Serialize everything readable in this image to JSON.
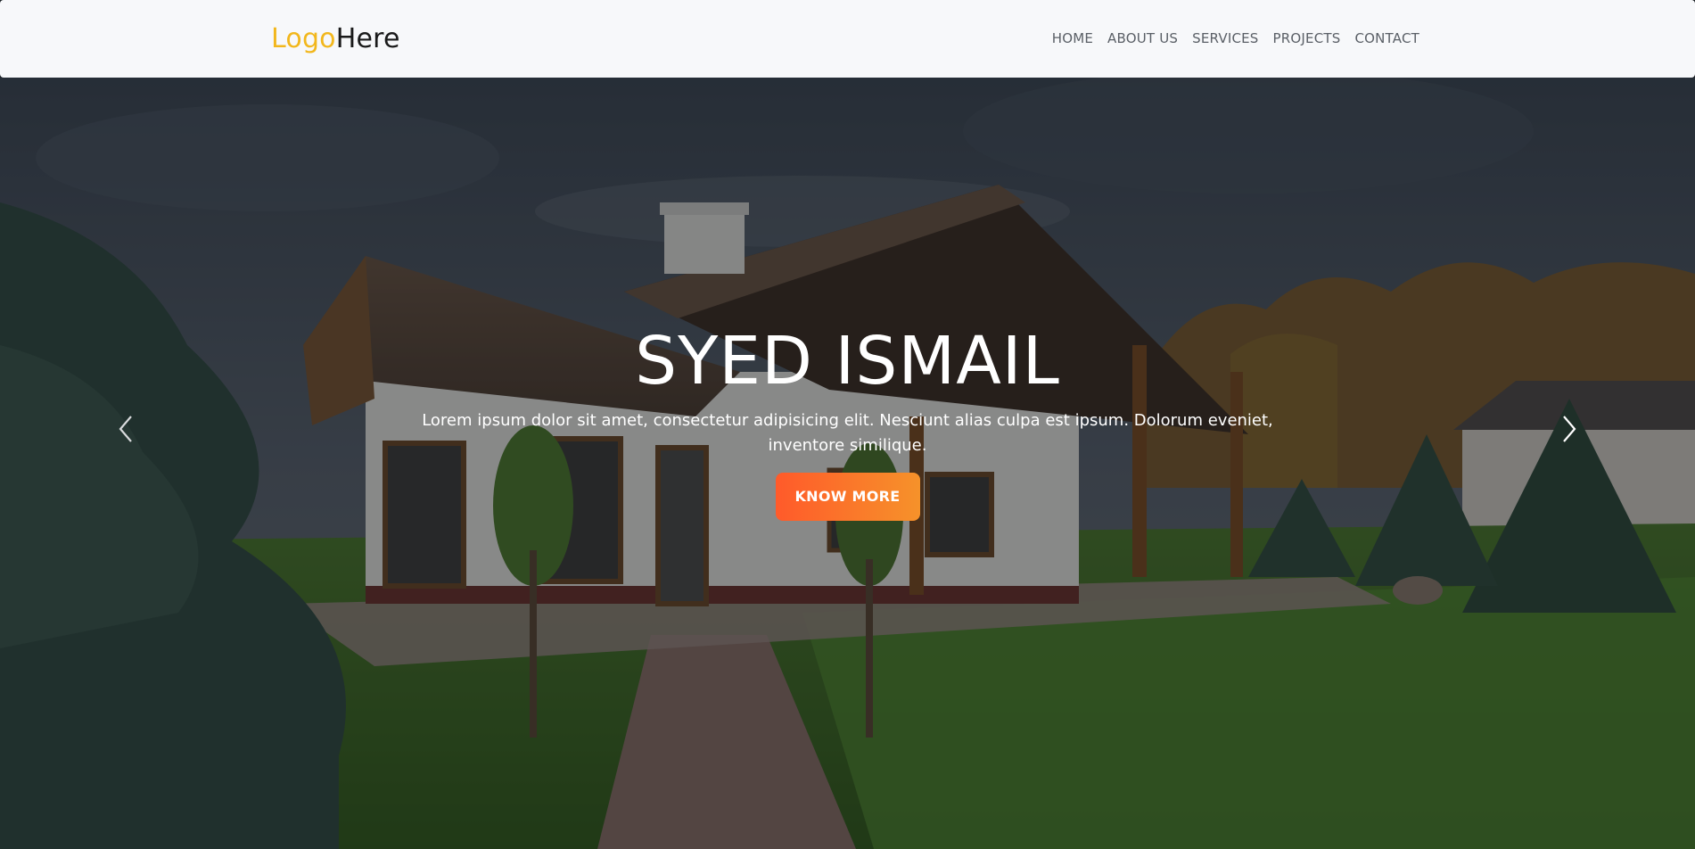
{
  "header": {
    "logo_part1": "Logo",
    "logo_part2": "Here",
    "logo_color": "#f2b71c",
    "nav": [
      "HOME",
      "ABOUT US",
      "SERVICES",
      "PROJECTS",
      "CONTACT"
    ]
  },
  "hero": {
    "title": "SYED ISMAIL",
    "text": "Lorem ipsum dolor sit amet, consectetur adipisicing elit. Nesciunt alias culpa est ipsum. Dolorum eveniet, inventore similique.",
    "cta_label": "KNOW MORE",
    "cta_gradient": [
      "#ff5a2a",
      "#f6922a"
    ],
    "prev_icon": "chevron-left-icon",
    "next_icon": "chevron-right-icon"
  }
}
